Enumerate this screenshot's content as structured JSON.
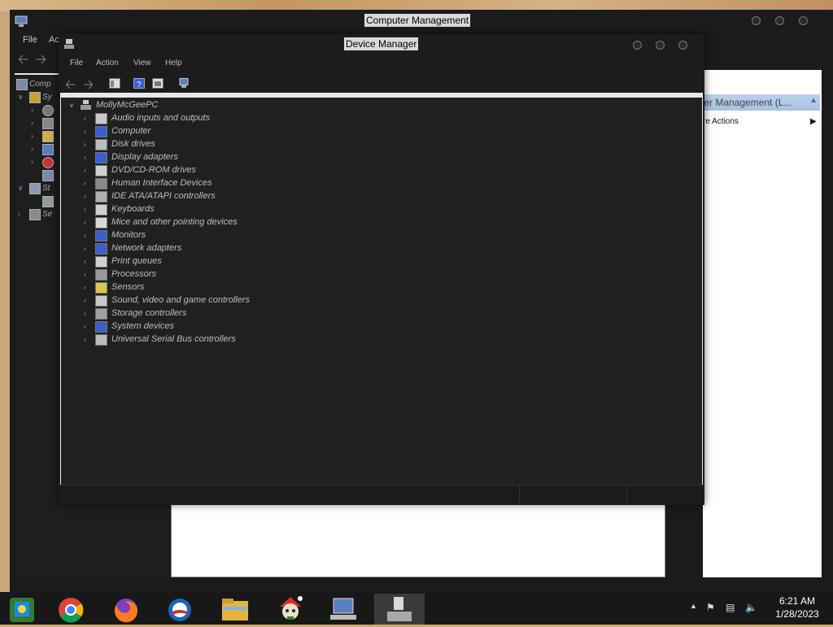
{
  "cm": {
    "title": "Computer Management",
    "menu": [
      "File",
      "Ac"
    ],
    "tree": [
      {
        "label": "Comp",
        "icon": "computer-management-icon",
        "level": 0
      },
      {
        "label": "Sy",
        "icon": "system-tools-icon",
        "level": 1
      },
      {
        "label": "",
        "icon": "task-scheduler-icon",
        "level": 2
      },
      {
        "label": "",
        "icon": "event-viewer-icon",
        "level": 2
      },
      {
        "label": "",
        "icon": "shared-folders-icon",
        "level": 2
      },
      {
        "label": "",
        "icon": "local-users-icon",
        "level": 2
      },
      {
        "label": "",
        "icon": "performance-icon",
        "level": 2
      },
      {
        "label": "",
        "icon": "device-manager-icon",
        "level": 2
      },
      {
        "label": "St",
        "icon": "storage-icon",
        "level": 1
      },
      {
        "label": "",
        "icon": "disk-management-icon",
        "level": 2
      },
      {
        "label": "Se",
        "icon": "services-icon",
        "level": 1
      }
    ],
    "actions": {
      "header": "ter Management (L...",
      "more": "re Actions"
    }
  },
  "dm": {
    "title": "Device Manager",
    "menu": [
      "File",
      "Action",
      "View",
      "Help"
    ],
    "root": "MollyMcGeePC",
    "devices": [
      {
        "label": "Audio inputs and outputs",
        "icon": "speaker-icon",
        "color": "#c8c8c8"
      },
      {
        "label": "Computer",
        "icon": "computer-icon",
        "color": "#3a5fcd"
      },
      {
        "label": "Disk drives",
        "icon": "disk-drive-icon",
        "color": "#bdbdbd"
      },
      {
        "label": "Display adapters",
        "icon": "display-adapter-icon",
        "color": "#3a5fcd"
      },
      {
        "label": "DVD/CD-ROM drives",
        "icon": "dvd-drive-icon",
        "color": "#d0d0d0"
      },
      {
        "label": "Human Interface Devices",
        "icon": "hid-icon",
        "color": "#8a8a8a"
      },
      {
        "label": "IDE ATA/ATAPI controllers",
        "icon": "ide-controller-icon",
        "color": "#b0b0b0"
      },
      {
        "label": "Keyboards",
        "icon": "keyboard-icon",
        "color": "#cfcfcf"
      },
      {
        "label": "Mice and other pointing devices",
        "icon": "mouse-icon",
        "color": "#d8d8d8"
      },
      {
        "label": "Monitors",
        "icon": "monitor-icon",
        "color": "#3a5fcd"
      },
      {
        "label": "Network adapters",
        "icon": "network-adapter-icon",
        "color": "#3a5fcd"
      },
      {
        "label": "Print queues",
        "icon": "printer-icon",
        "color": "#d0d0d0"
      },
      {
        "label": "Processors",
        "icon": "processor-icon",
        "color": "#9a9a9a"
      },
      {
        "label": "Sensors",
        "icon": "sensor-icon",
        "color": "#d9c84a"
      },
      {
        "label": "Sound, video and game controllers",
        "icon": "sound-icon",
        "color": "#c8c8c8"
      },
      {
        "label": "Storage controllers",
        "icon": "storage-controller-icon",
        "color": "#a0a0a0"
      },
      {
        "label": "System devices",
        "icon": "system-device-icon",
        "color": "#3a5fcd"
      },
      {
        "label": "Universal Serial Bus controllers",
        "icon": "usb-icon",
        "color": "#bdbdbd"
      }
    ]
  },
  "taskbar": {
    "apps": [
      {
        "name": "windows-store-icon",
        "active": false
      },
      {
        "name": "chrome-icon",
        "active": false
      },
      {
        "name": "firefox-icon",
        "active": false
      },
      {
        "name": "obama-logo-icon",
        "active": false
      },
      {
        "name": "file-explorer-icon",
        "active": false
      },
      {
        "name": "santa-skull-icon",
        "active": false
      },
      {
        "name": "computer-management-icon",
        "active": false
      },
      {
        "name": "device-manager-icon",
        "active": true
      }
    ],
    "time": "6:21 AM",
    "date": "1/28/2023"
  }
}
